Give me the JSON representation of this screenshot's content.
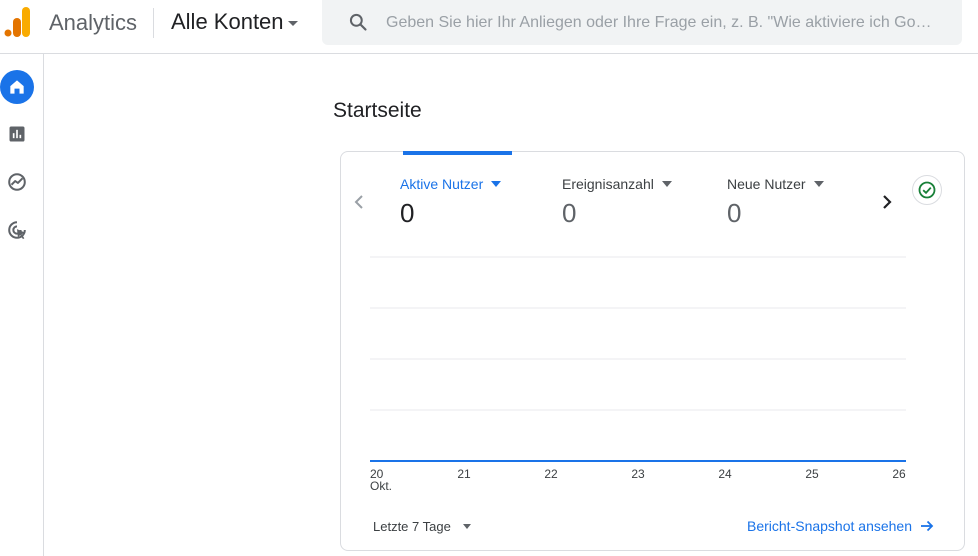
{
  "header": {
    "app_name": "Analytics",
    "account_label": "Alle Konten",
    "search_placeholder": "Geben Sie hier Ihr Anliegen oder Ihre Frage ein, z. B. \"Wie aktiviere ich Go…",
    "search_value": ""
  },
  "rail": {
    "items": [
      {
        "icon": "home-icon",
        "active": true
      },
      {
        "icon": "reports-icon",
        "active": false
      },
      {
        "icon": "explore-icon",
        "active": false
      },
      {
        "icon": "advertising-icon",
        "active": false
      }
    ]
  },
  "main": {
    "title": "Startseite",
    "metrics": [
      {
        "label": "Aktive Nutzer",
        "value": "0",
        "active": true
      },
      {
        "label": "Ereignisanzahl",
        "value": "0",
        "active": false
      },
      {
        "label": "Neue Nutzer",
        "value": "0",
        "active": false
      }
    ],
    "chart_data": {
      "type": "line",
      "categories": [
        "20 Okt.",
        "21",
        "22",
        "23",
        "24",
        "25",
        "26"
      ],
      "x_tick_lines": [
        [
          "20",
          "Okt."
        ],
        [
          "21"
        ],
        [
          "22"
        ],
        [
          "23"
        ],
        [
          "24"
        ],
        [
          "25"
        ],
        [
          "26"
        ]
      ],
      "series": [
        {
          "values": [
            0,
            0,
            0,
            0,
            0,
            0,
            0
          ]
        }
      ],
      "grid": true,
      "line_color": "#1a73e8"
    },
    "date_range": "Letzte 7 Tage",
    "snapshot_link": "Bericht-Snapshot ansehen"
  },
  "colors": {
    "accent": "#1a73e8",
    "success": "#188038",
    "logo_orange": "#f9ab00",
    "logo_dark_orange": "#e37400"
  }
}
